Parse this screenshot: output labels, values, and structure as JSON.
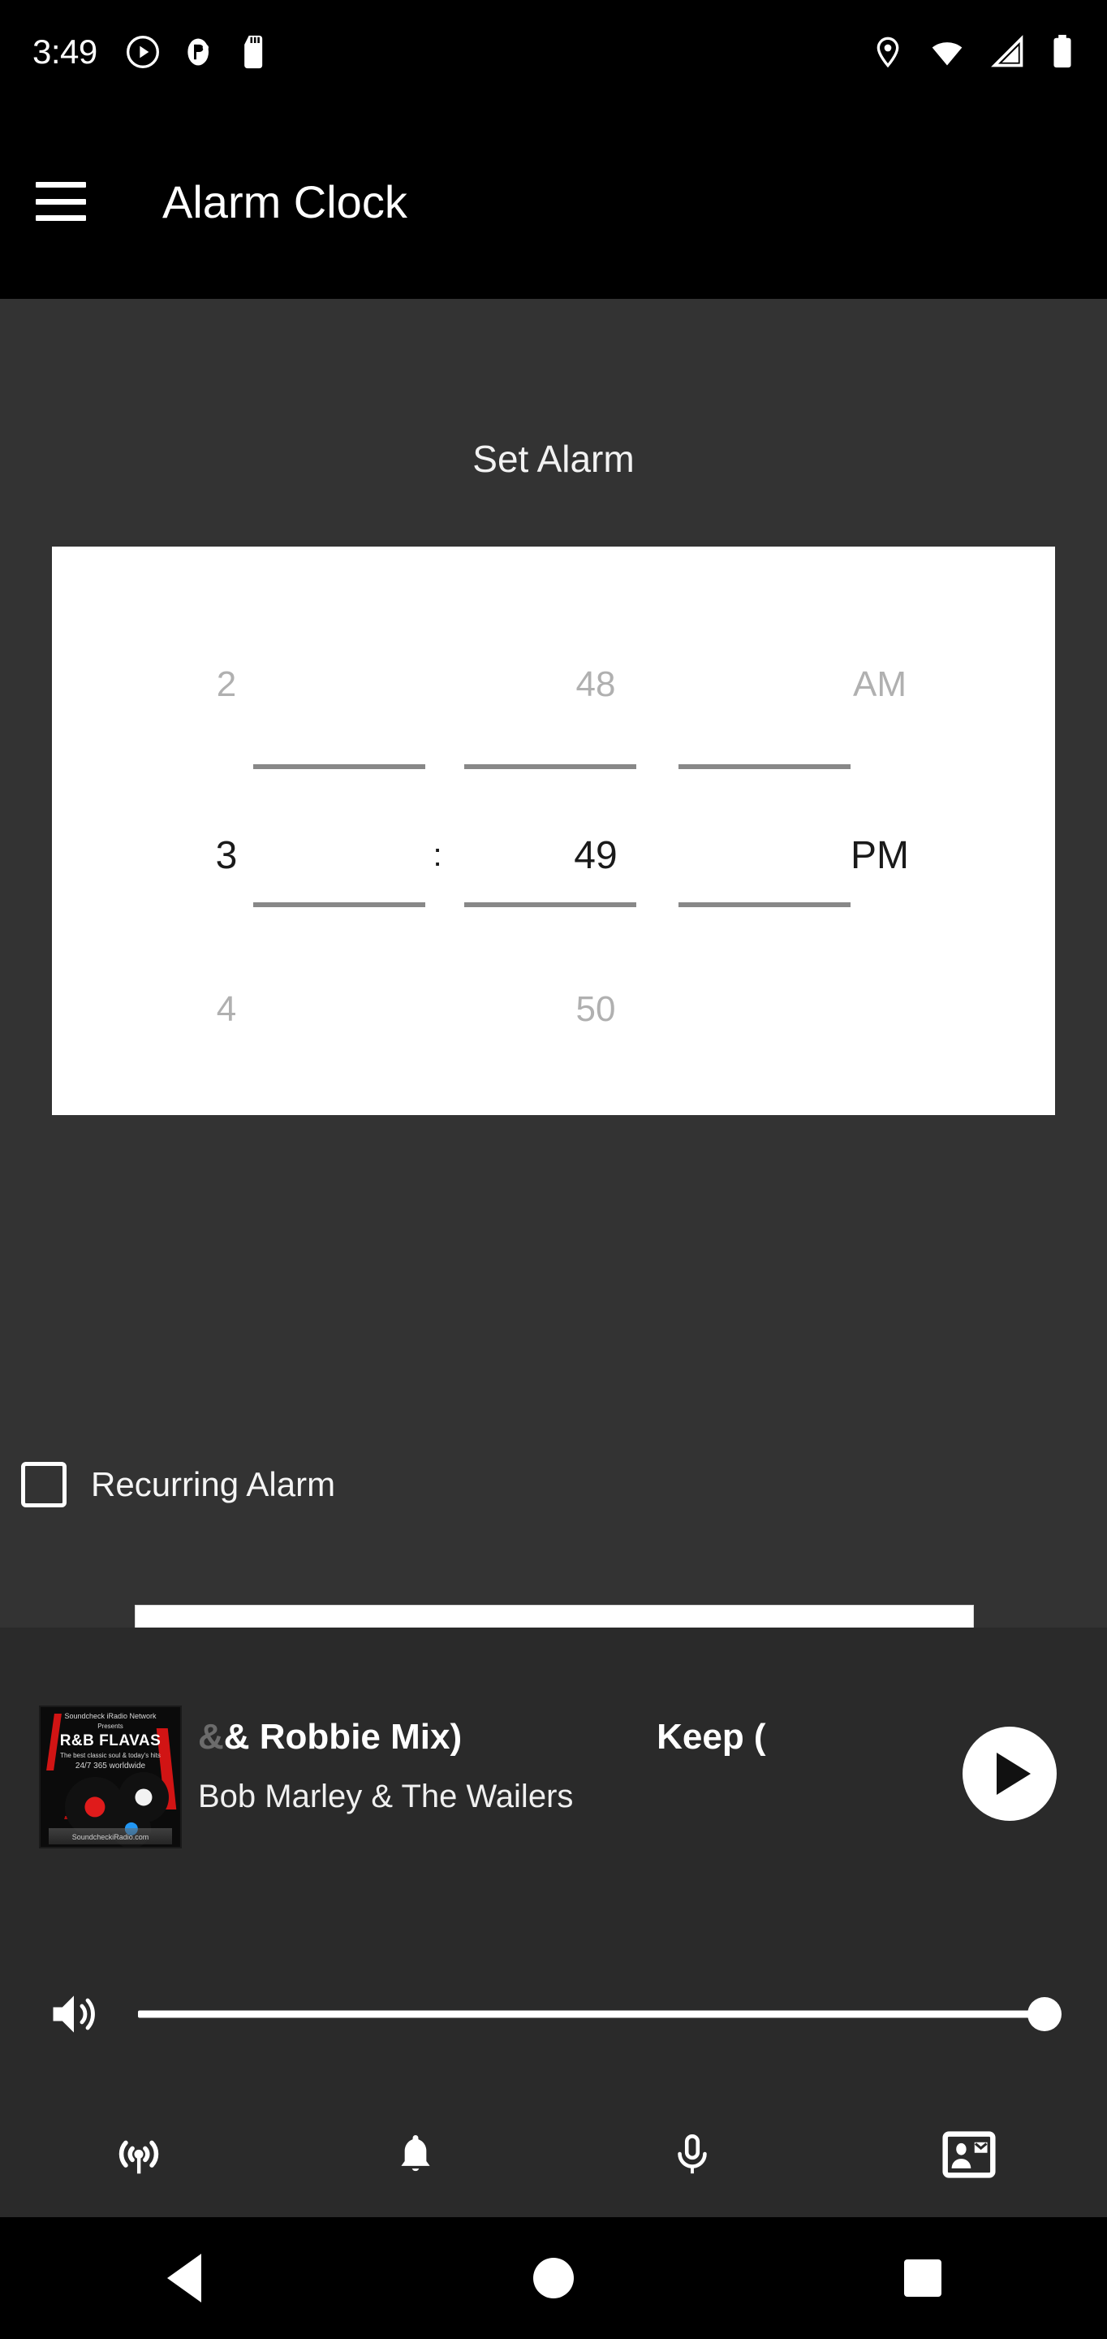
{
  "status_bar": {
    "time": "3:49",
    "left_icons": [
      "play-circle-icon",
      "do-not-disturb-icon",
      "sd-card-icon"
    ],
    "right_icons": [
      "location-pin-icon",
      "wifi-icon",
      "cellular-signal-icon",
      "battery-icon"
    ]
  },
  "app_bar": {
    "menu_icon": "hamburger-menu-icon",
    "title": "Alarm Clock"
  },
  "main": {
    "section_title": "Set Alarm",
    "time_picker": {
      "previous": {
        "hour": "2",
        "minute": "48",
        "period": "AM"
      },
      "selected": {
        "hour": "3",
        "separator": ":",
        "minute": "49",
        "period": "PM"
      },
      "next": {
        "hour": "4",
        "minute": "50",
        "period": ""
      }
    },
    "recurring_alarm": {
      "label": "Recurring Alarm",
      "checked": false
    },
    "empty_fields": [
      "",
      ""
    ],
    "drag_handle": "sheet-drag-handle"
  },
  "player": {
    "album_art": {
      "network": "Soundcheck iRadio Network",
      "presents": "Presents",
      "title": "R&B FLAVAS",
      "tagline_1": "The best classic soul & today's hits",
      "tagline_2": "24/7 365 worldwide",
      "footer": "SoundcheckiRadio.com"
    },
    "track_title": "& Robbie Mix)",
    "track_title_secondary": "Keep (",
    "track_artist": "Bob Marley & The Wailers",
    "play_button": "play-button",
    "volume": {
      "icon": "volume-up-icon",
      "level": 100
    }
  },
  "tab_bar": {
    "tabs": [
      {
        "name": "tab-broadcast",
        "icon": "broadcast-tower-icon"
      },
      {
        "name": "tab-alarm",
        "icon": "bell-icon"
      },
      {
        "name": "tab-microphone",
        "icon": "microphone-icon"
      },
      {
        "name": "tab-contact",
        "icon": "contact-mail-icon"
      }
    ]
  },
  "nav_bar": {
    "buttons": [
      {
        "name": "nav-back",
        "icon": "back-triangle-icon"
      },
      {
        "name": "nav-home",
        "icon": "home-circle-icon"
      },
      {
        "name": "nav-recent",
        "icon": "recents-square-icon"
      }
    ]
  },
  "colors": {
    "status_bar_bg": "#000000",
    "app_bar_bg": "#000000",
    "content_bg": "#333333",
    "sheet_bg": "#2a2a2a",
    "card_bg": "#ffffff",
    "dim_text": "#b0b0b0",
    "accent_red": "#d11414"
  }
}
